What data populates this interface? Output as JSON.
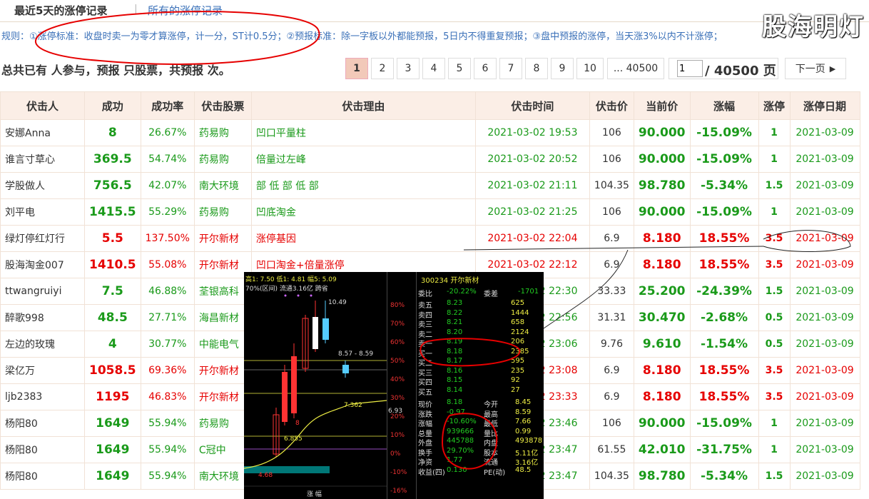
{
  "tabs": {
    "active": "最近5天的涨停记录",
    "separator": "|",
    "link": "所有的涨停记录"
  },
  "watermark": "股海明灯",
  "rules": "规则：①涨停标准：收盘时卖一为零才算涨停，计一分，ST计0.5分；②预报标准：除一字板以外都能预报，5日内不得重复预报；③盘中预报的涨停，当天涨3%以内不计涨停；",
  "summary": "总共已有  人参与，预报  只股票，共预报  次。",
  "pager": {
    "pages": [
      "1",
      "2",
      "3",
      "4",
      "5",
      "6",
      "7",
      "8",
      "9",
      "10",
      "... 40500"
    ],
    "input_value": "1",
    "total": "/ 40500 页",
    "next": "下一页"
  },
  "table": {
    "headers": [
      "伏击人",
      "成功",
      "成功率",
      "伏击股票",
      "伏击理由",
      "伏击时间",
      "伏击价",
      "当前价",
      "涨幅",
      "涨停",
      "涨停日期"
    ],
    "rows": [
      {
        "user": "安娜Anna",
        "success": "8",
        "rate": "26.67%",
        "stock": "药易购",
        "reason": "凹口平量柱",
        "time": "2021-03-02 19:53",
        "price": "106",
        "current": "90.000",
        "change": "-15.09%",
        "limit": "1",
        "date": "2021-03-09",
        "tone": "g"
      },
      {
        "user": "谁言寸草心",
        "success": "369.5",
        "rate": "54.74%",
        "stock": "药易购",
        "reason": "倍量过左峰",
        "time": "2021-03-02 20:52",
        "price": "106",
        "current": "90.000",
        "change": "-15.09%",
        "limit": "1",
        "date": "2021-03-09",
        "tone": "g"
      },
      {
        "user": "学股做人",
        "success": "756.5",
        "rate": "42.07%",
        "stock": "南大环境",
        "reason": "部 低 部 低 部",
        "time": "2021-03-02 21:11",
        "price": "104.35",
        "current": "98.780",
        "change": "-5.34%",
        "limit": "1.5",
        "date": "2021-03-09",
        "tone": "g"
      },
      {
        "user": "刘平电",
        "success": "1415.5",
        "rate": "55.29%",
        "stock": "药易购",
        "reason": "凹底淘金",
        "time": "2021-03-02 21:25",
        "price": "106",
        "current": "90.000",
        "change": "-15.09%",
        "limit": "1",
        "date": "2021-03-09",
        "tone": "g"
      },
      {
        "user": "绿灯停红灯行",
        "success": "5.5",
        "rate": "137.50%",
        "stock": "开尔新材",
        "reason": "涨停基因",
        "time": "2021-03-02 22:04",
        "price": "6.9",
        "current": "8.180",
        "change": "18.55%",
        "limit": "3.5",
        "date": "2021-03-09",
        "tone": "r"
      },
      {
        "user": "股海淘金007",
        "success": "1410.5",
        "rate": "55.08%",
        "stock": "开尔新材",
        "reason": "凹口淘金+倍量涨停",
        "time": "2021-03-02 22:12",
        "price": "6.9",
        "current": "8.180",
        "change": "18.55%",
        "limit": "3.5",
        "date": "2021-03-09",
        "tone": "r"
      },
      {
        "user": "ttwangruiyi",
        "success": "7.5",
        "rate": "46.88%",
        "stock": "荃银高科",
        "reason": "",
        "time": "2021-03-02 22:30",
        "price": "33.33",
        "current": "25.200",
        "change": "-24.39%",
        "limit": "1.5",
        "date": "2021-03-09",
        "tone": "g"
      },
      {
        "user": "醉歌998",
        "success": "48.5",
        "rate": "27.71%",
        "stock": "海昌新材",
        "reason": "",
        "time": "2021-03-02 22:56",
        "price": "31.31",
        "current": "30.470",
        "change": "-2.68%",
        "limit": "0.5",
        "date": "2021-03-09",
        "tone": "g"
      },
      {
        "user": "左边的玫瑰",
        "success": "4",
        "rate": "30.77%",
        "stock": "中能电气",
        "reason": "",
        "time": "2021-03-02 23:06",
        "price": "9.76",
        "current": "9.610",
        "change": "-1.54%",
        "limit": "0.5",
        "date": "2021-03-09",
        "tone": "g"
      },
      {
        "user": "梁亿万",
        "success": "1058.5",
        "rate": "69.36%",
        "stock": "开尔新材",
        "reason": "",
        "time": "2021-03-02 23:08",
        "price": "6.9",
        "current": "8.180",
        "change": "18.55%",
        "limit": "3.5",
        "date": "2021-03-09",
        "tone": "r"
      },
      {
        "user": "ljb2383",
        "success": "1195",
        "rate": "46.83%",
        "stock": "开尔新材",
        "reason": "",
        "time": "2021-03-02 23:33",
        "price": "6.9",
        "current": "8.180",
        "change": "18.55%",
        "limit": "3.5",
        "date": "2021-03-09",
        "tone": "r"
      },
      {
        "user": "杨阳80",
        "success": "1649",
        "rate": "55.94%",
        "stock": "药易购",
        "reason": "",
        "time": "2021-03-02 23:46",
        "price": "106",
        "current": "90.000",
        "change": "-15.09%",
        "limit": "1",
        "date": "2021-03-09",
        "tone": "g"
      },
      {
        "user": "杨阳80",
        "success": "1649",
        "rate": "55.94%",
        "stock": "C冠中",
        "reason": "",
        "time": "2021-03-02 23:47",
        "price": "61.55",
        "current": "42.010",
        "change": "-31.75%",
        "limit": "1",
        "date": "2021-03-09",
        "tone": "g"
      },
      {
        "user": "杨阳80",
        "success": "1649",
        "rate": "55.94%",
        "stock": "南大环境",
        "reason": "",
        "time": "2021-03-02 23:47",
        "price": "104.35",
        "current": "98.780",
        "change": "-5.34%",
        "limit": "1.5",
        "date": "2021-03-09",
        "tone": "g"
      }
    ]
  },
  "overlay": {
    "head1": "高1: 7.50  低1: 4.81  幅5: 5.09",
    "head2": "70%(区间)  流通3.16亿  跨省",
    "labels": [
      "10.49",
      "8.57 - 8.59",
      "7.362",
      "6.855",
      "8",
      "6.93",
      "4.68",
      "涨  幅"
    ],
    "percents": [
      "80%",
      "70%",
      "60%",
      "50%",
      "40%",
      "30%",
      "20%",
      "10%",
      "0%",
      "-10%",
      "-16%"
    ],
    "stock_title": "300234 开尔新材",
    "weibi": {
      "label": "委比",
      "value": "-20.22%",
      "label2": "委差",
      "value2": "-1701"
    },
    "asks": [
      [
        "卖五",
        "8.23",
        "625"
      ],
      [
        "卖四",
        "8.22",
        "1444"
      ],
      [
        "卖三",
        "8.21",
        "658"
      ],
      [
        "卖二",
        "8.20",
        "2124"
      ],
      [
        "卖一",
        "8.19",
        "206"
      ]
    ],
    "bids": [
      [
        "买一",
        "8.18",
        "2385"
      ],
      [
        "买二",
        "8.17",
        "595"
      ],
      [
        "买三",
        "8.16",
        "235"
      ],
      [
        "买四",
        "8.15",
        "92"
      ],
      [
        "买五",
        "8.14",
        "27"
      ]
    ],
    "stats": [
      [
        "现价",
        "8.18",
        "今开",
        "8.45"
      ],
      [
        "涨跌",
        "-0.97",
        "最高",
        "8.59"
      ],
      [
        "涨幅",
        "-10.60%",
        "最低",
        "7.66"
      ],
      [
        "总量",
        "939666",
        "量比",
        "0.99"
      ],
      [
        "外盘",
        "445788",
        "内盘",
        "493878"
      ],
      [
        "换手",
        "29.70%",
        "股本",
        "5.11亿"
      ],
      [
        "净资",
        "1.77",
        "流通",
        "3.16亿"
      ],
      [
        "收益(四)",
        "0.130",
        "PE(动)",
        "48.5"
      ]
    ]
  },
  "colors": {
    "green": "#1a9a1a",
    "red": "#e60000",
    "header_bg": "#fbeee6",
    "link": "#3a70b8"
  }
}
